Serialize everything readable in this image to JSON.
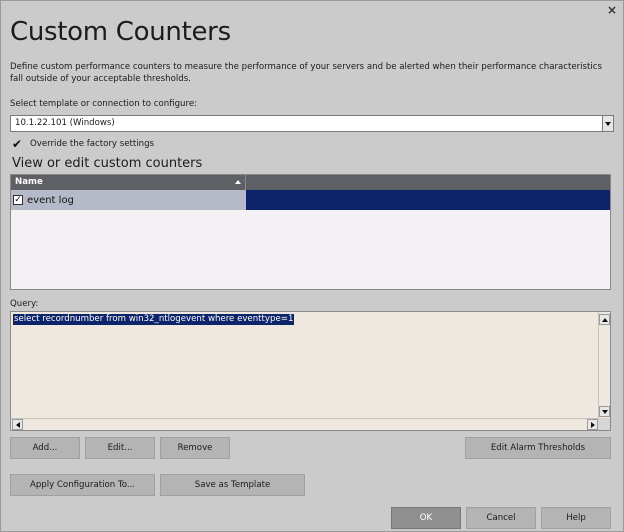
{
  "window": {
    "title": "Custom Counters",
    "close_glyph": "×",
    "description": "Define custom performance counters to measure the performance of your servers and be alerted when their performance characteristics fall outside of your acceptable thresholds."
  },
  "template_select": {
    "label": "Select template or connection to configure:",
    "value": "10.1.22.101 (Windows)"
  },
  "override": {
    "label": "Override the factory settings",
    "checked": true
  },
  "counters": {
    "heading": "View or edit custom counters",
    "columns": [
      "Name"
    ],
    "rows": [
      {
        "name": "event log",
        "checked": true,
        "selected": true
      }
    ]
  },
  "query": {
    "label": "Query:",
    "value": "select recordnumber from win32_ntlogevent where eventtype=1"
  },
  "buttons": {
    "add": "Add...",
    "edit": "Edit...",
    "remove": "Remove",
    "edit_alarm": "Edit Alarm Thresholds",
    "apply_config": "Apply Configuration To...",
    "save_template": "Save as Template",
    "ok": "OK",
    "cancel": "Cancel",
    "help": "Help"
  },
  "icons": {
    "close": "close-icon",
    "check": "checkmark-icon",
    "dropdown": "chevron-down-icon",
    "sort": "sort-ascending-icon"
  },
  "colors": {
    "selection": "#0d246a",
    "header": "#5e6066",
    "background": "#cbcbcb"
  }
}
